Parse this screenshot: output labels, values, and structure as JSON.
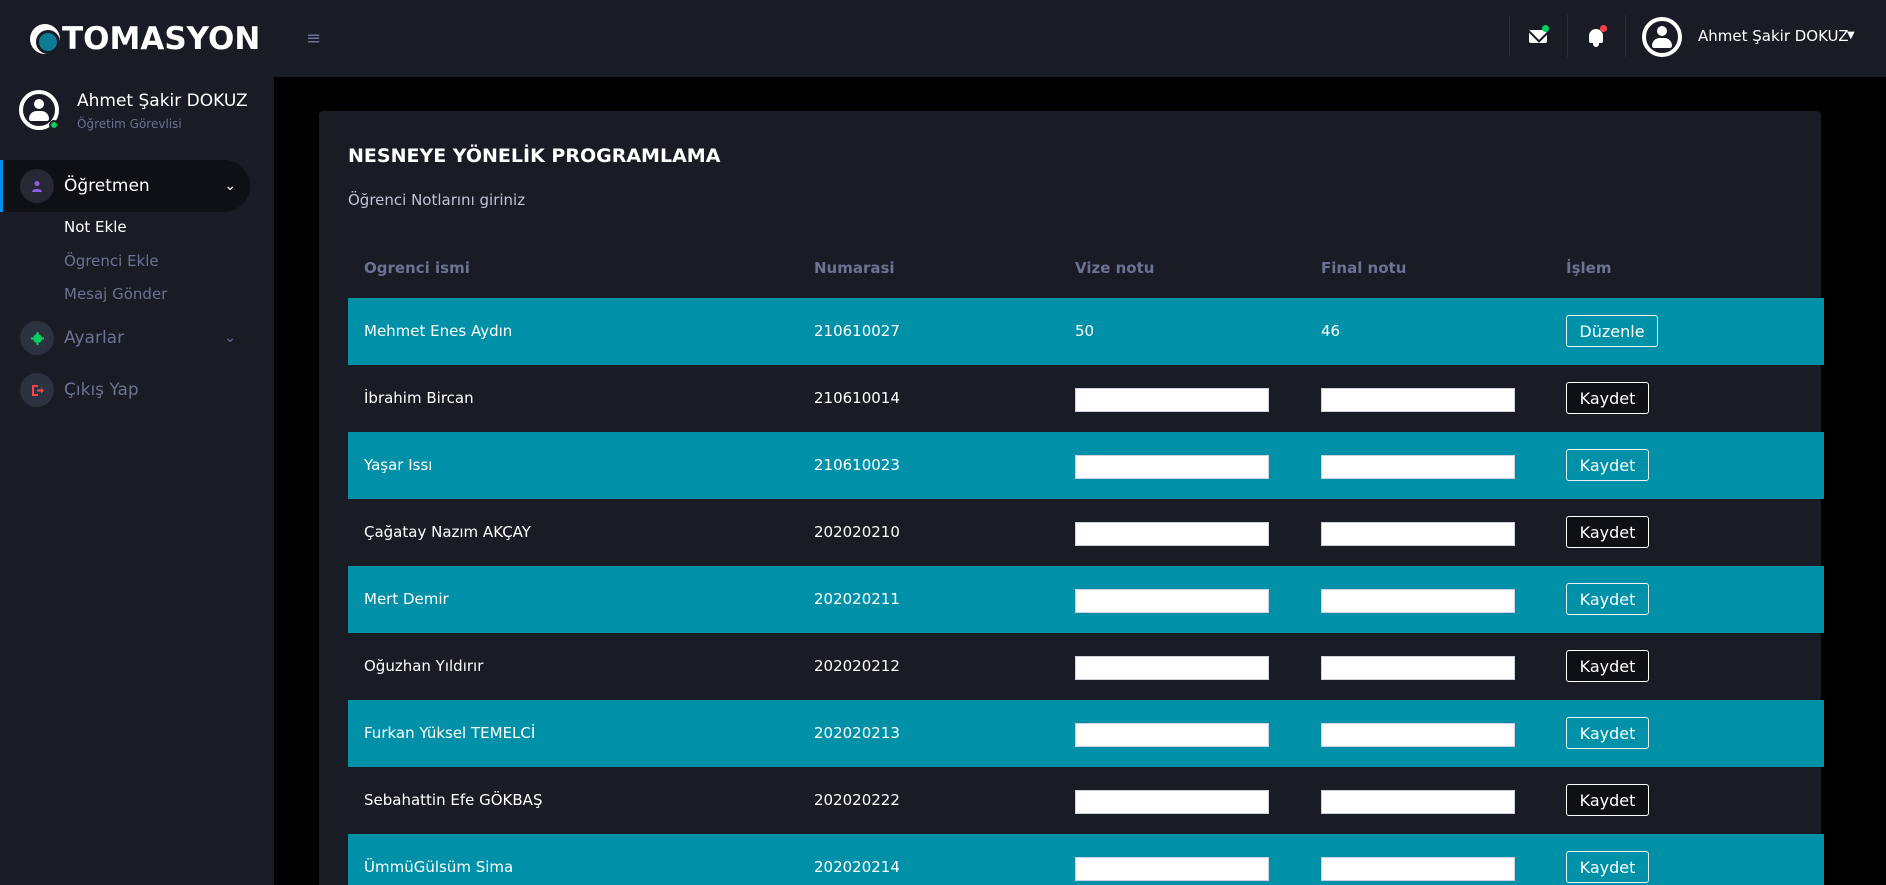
{
  "brand": {
    "text": "TOMASYON"
  },
  "sidebar": {
    "profile": {
      "name": "Ahmet Şakir DOKUZ",
      "role": "Öğretim Görevlisi"
    },
    "items": [
      {
        "label": "Öğretmen",
        "icon": "user-icon",
        "icon_color": "#8f5fe8"
      },
      {
        "label": "Ayarlar",
        "icon": "gear-icon",
        "icon_color": "#00d25b"
      },
      {
        "label": "Çıkış Yap",
        "icon": "logout-icon",
        "icon_color": "#fc424a"
      }
    ],
    "subitems": [
      "Not Ekle",
      "Ögrenci Ekle",
      "Mesaj Gönder"
    ]
  },
  "topbar": {
    "username": "Ahmet Şakir DOKUZ"
  },
  "card": {
    "title": "NESNEYE YÖNELİK PROGRAMLAMA",
    "description": "Öğrenci Notlarını giriniz"
  },
  "table": {
    "headers": [
      "Ogrenci ismi",
      "Numarasi",
      "Vize notu",
      "Final notu",
      "İşlem"
    ],
    "rows": [
      {
        "name": "Mehmet Enes Aydın",
        "number": "210610027",
        "midterm": "50",
        "final": "46",
        "action": "Düzenle"
      },
      {
        "name": "İbrahim Bircan",
        "number": "210610014",
        "midterm": "",
        "final": "",
        "action": "Kaydet"
      },
      {
        "name": "Yaşar Issı",
        "number": "210610023",
        "midterm": "",
        "final": "",
        "action": "Kaydet"
      },
      {
        "name": "Çağatay Nazım AKÇAY",
        "number": "202020210",
        "midterm": "",
        "final": "",
        "action": "Kaydet"
      },
      {
        "name": "Mert Demir",
        "number": "202020211",
        "midterm": "",
        "final": "",
        "action": "Kaydet"
      },
      {
        "name": "Oğuzhan Yıldırır",
        "number": "202020212",
        "midterm": "",
        "final": "",
        "action": "Kaydet"
      },
      {
        "name": "Furkan Yüksel TEMELCİ",
        "number": "202020213",
        "midterm": "",
        "final": "",
        "action": "Kaydet"
      },
      {
        "name": "Sebahattin Efe GÖKBAŞ",
        "number": "202020222",
        "midterm": "",
        "final": "",
        "action": "Kaydet"
      },
      {
        "name": "ÜmmüGülsüm Sima",
        "number": "202020214",
        "midterm": "",
        "final": "",
        "action": "Kaydet"
      }
    ]
  }
}
